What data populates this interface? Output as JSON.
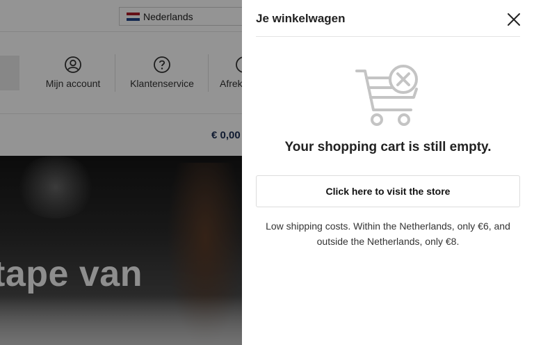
{
  "topbar": {
    "language": "Nederlands",
    "flag_colors": [
      "#ae1c28",
      "#ffffff",
      "#21468b"
    ]
  },
  "header": {
    "nav": [
      {
        "label": "Mijn account",
        "icon": "user-circle-icon"
      },
      {
        "label": "Klantenservice",
        "icon": "question-circle-icon"
      },
      {
        "label": "Afreken",
        "icon": "checkout-icon"
      }
    ],
    "cart_total": "€ 0,00"
  },
  "hero": {
    "text": "tape van"
  },
  "cart": {
    "title": "Je winkelwagen",
    "close_icon": "close-icon",
    "graphic_icon": "empty-cart-icon",
    "empty_message": "Your shopping cart is still empty.",
    "store_button": "Click here to visit the store",
    "shipping_note": "Low shipping costs. Within the Netherlands, only €6, and outside the Netherlands, only €8."
  },
  "colors": {
    "overlay": "rgba(0,0,0,0.42)",
    "price_text": "#1d2f55",
    "icon_gray": "#c4c4c4"
  }
}
